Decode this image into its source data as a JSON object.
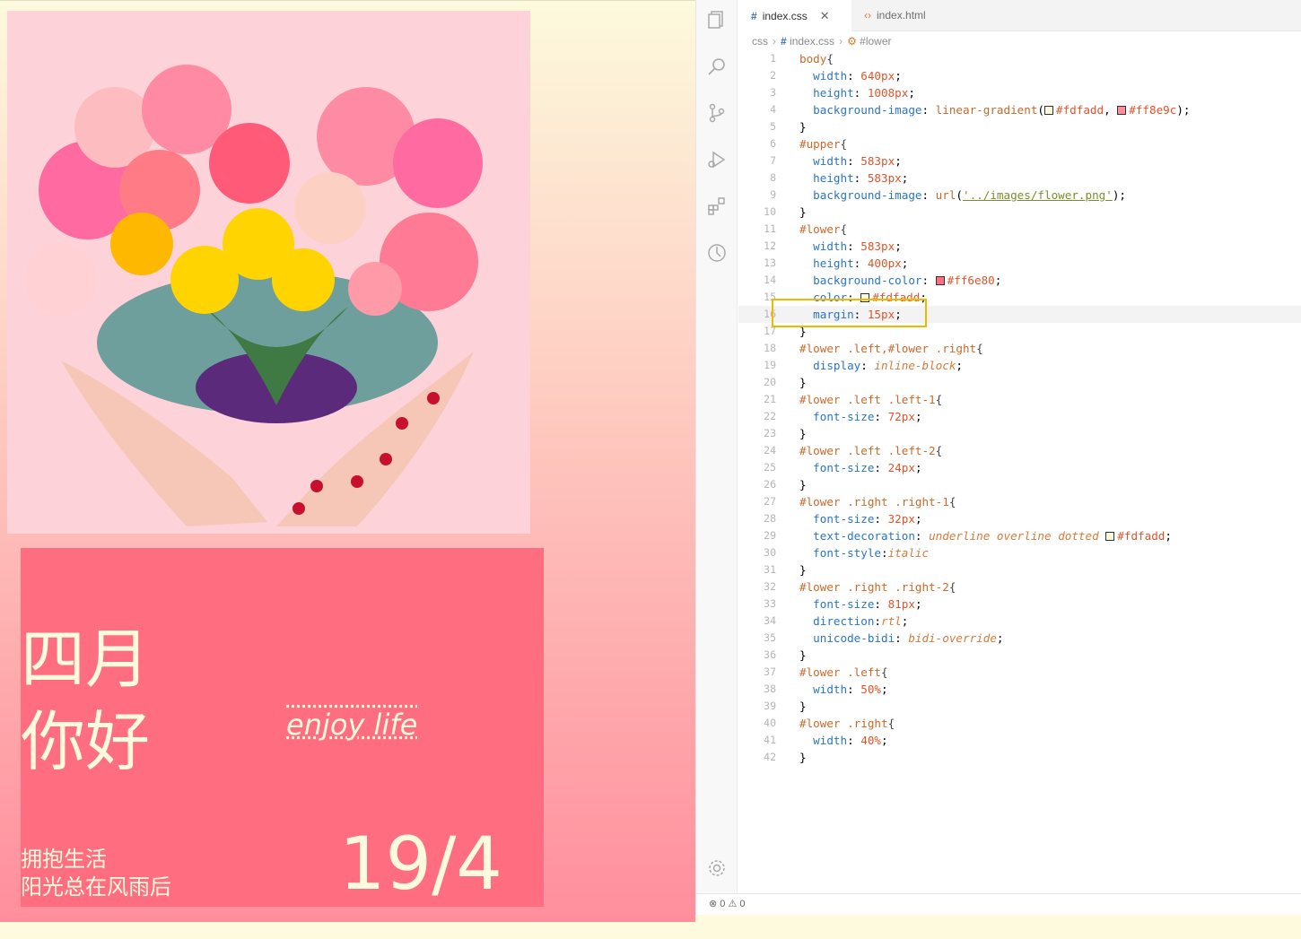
{
  "preview": {
    "left1": [
      "四月",
      "你好"
    ],
    "left2": [
      "拥抱生活",
      "阳光总在风雨后"
    ],
    "right1": "enjoy life",
    "right2": "19/4",
    "colors": {
      "top": "#fdfadd",
      "bottom": "#ff8e9c",
      "lower_bg": "#ff6e80"
    }
  },
  "editor": {
    "tabs": [
      {
        "label": "index.css",
        "icon": "css-hash-icon",
        "active": true
      },
      {
        "label": "index.html",
        "icon": "html-code-icon",
        "active": false
      }
    ],
    "breadcrumb": [
      "css",
      "index.css",
      "#lower"
    ],
    "status": {
      "errors": "0",
      "warnings": "0"
    },
    "code_lines": [
      "body{",
      "  width: 640px;",
      "  height: 1008px;",
      "  background-image: linear-gradient(#fdfadd, #ff8e9c);",
      "}",
      "#upper{",
      "  width: 583px;",
      "  height: 583px;",
      "  background-image: url('../images/flower.png');",
      "}",
      "#lower{",
      "  width: 583px;",
      "  height: 400px;",
      "  background-color: #ff6e80;",
      "  color: #fdfadd;",
      "  margin: 15px;",
      "}",
      "#lower .left,#lower .right{",
      "  display: inline-block;",
      "}",
      "#lower .left .left-1{",
      "  font-size: 72px;",
      "}",
      "#lower .left .left-2{",
      "  font-size: 24px;",
      "}",
      "#lower .right .right-1{",
      "  font-size: 32px;",
      "  text-decoration: underline overline dotted #fdfadd;",
      "  font-style:italic",
      "}",
      "#lower .right .right-2{",
      "  font-size: 81px;",
      "  direction:rtl;",
      "  unicode-bidi: bidi-override;",
      "}",
      "#lower .left{",
      "  width: 50%;",
      "}",
      "#lower .right{",
      "  width: 40%;",
      "}"
    ]
  }
}
